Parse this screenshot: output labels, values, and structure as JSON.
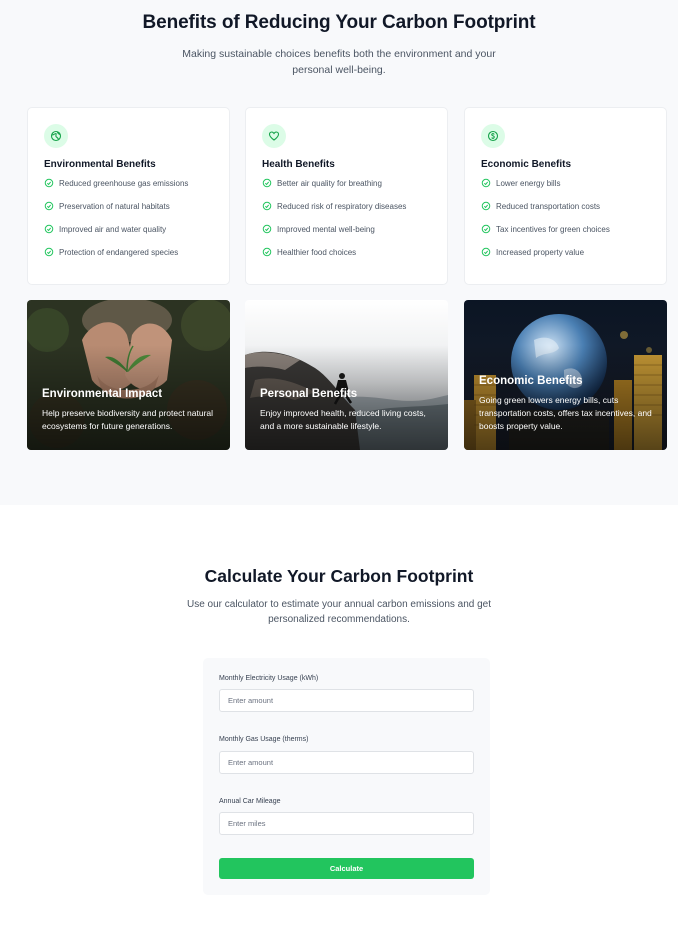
{
  "benefits": {
    "title": "Benefits of Reducing Your Carbon Footprint",
    "subtitle": "Making sustainable choices benefits both the environment and your personal well-being.",
    "cards": [
      {
        "icon": "globe-icon",
        "title": "Environmental Benefits",
        "items": [
          "Reduced greenhouse gas emissions",
          "Preservation of natural habitats",
          "Improved air and water quality",
          "Protection of endangered species"
        ]
      },
      {
        "icon": "heart-icon",
        "title": "Health Benefits",
        "items": [
          "Better air quality for breathing",
          "Reduced risk of respiratory diseases",
          "Improved mental well-being",
          "Healthier food choices"
        ]
      },
      {
        "icon": "dollar-coin-icon",
        "title": "Economic Benefits",
        "items": [
          "Lower energy bills",
          "Reduced transportation costs",
          "Tax incentives for green choices",
          "Increased property value"
        ]
      }
    ],
    "image_cards": [
      {
        "title": "Environmental Impact",
        "text": "Help preserve biodiversity and protect natural ecosystems for future generations."
      },
      {
        "title": "Personal Benefits",
        "text": "Enjoy improved health, reduced living costs, and a more sustainable lifestyle."
      },
      {
        "title": "Economic Benefits",
        "text": "Going green lowers energy bills, cuts transportation costs, offers tax incentives, and boosts property value."
      }
    ]
  },
  "calculator": {
    "title": "Calculate Your Carbon Footprint",
    "subtitle": "Use our calculator to estimate your annual carbon emissions and get personalized recommendations.",
    "fields": [
      {
        "label": "Monthly Electricity Usage (kWh)",
        "placeholder": "Enter amount",
        "value": ""
      },
      {
        "label": "Monthly Gas Usage (therms)",
        "placeholder": "Enter amount",
        "value": ""
      },
      {
        "label": "Annual Car Mileage",
        "placeholder": "Enter miles",
        "value": ""
      }
    ],
    "button_label": "Calculate"
  },
  "colors": {
    "accent": "#22c55e",
    "accent_light": "#dcfce7",
    "section_bg": "#f8f9fb"
  }
}
